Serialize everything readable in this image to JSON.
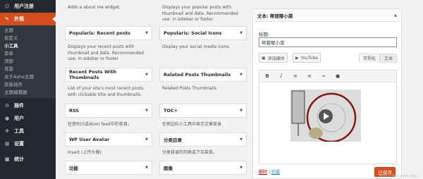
{
  "sidebar": {
    "top_item": "用户注册",
    "current": "外观",
    "submenu": [
      "主题",
      "自定义",
      "小工具",
      "菜单",
      "顶部",
      "背景",
      "关于Ashe主题",
      "安装插件",
      "主题编辑器"
    ],
    "bottom_items": [
      {
        "label": "插件",
        "icon": "plugin-icon"
      },
      {
        "label": "用户",
        "icon": "user-icon"
      },
      {
        "label": "工具",
        "icon": "tools-icon"
      },
      {
        "label": "设置",
        "icon": "settings-icon"
      },
      {
        "label": "统计",
        "icon": "stats-icon"
      }
    ]
  },
  "col1": {
    "top_desc": "Adds a about me widget.",
    "widgets": [
      {
        "title": "Popularis: Recent posts",
        "desc": "Displays your recent posts with thumbnail and date. Recommended use: in sidebar or footer"
      },
      {
        "title": "Recent Posts With Thumbnails",
        "desc": "List of your site's most recent posts, with clickable title and thumbnails."
      },
      {
        "title": "RSS",
        "desc": "任意RSS或Atom feed中的条目。"
      },
      {
        "title": "WP User Avatar",
        "desc": "Insert (上传头像)."
      },
      {
        "title": "功能",
        "desc": ""
      }
    ]
  },
  "col2": {
    "top_desc": "Displays your popular posts with thumbnail and date. Recommended use: in sidebar or footer",
    "widgets": [
      {
        "title": "Popularis: Social Icons",
        "desc": "Display your social media icons."
      },
      {
        "title": "Related Posts Thumbnails",
        "desc": "Related Posts Thumbnails"
      },
      {
        "title": "TOC+",
        "desc": "在侧边栏小工具中显示文章目录"
      },
      {
        "title": "分类目录",
        "desc": "分类目录的列表或下拉菜单。"
      },
      {
        "title": "图像",
        "desc": ""
      }
    ]
  },
  "panel": {
    "title": "文本: 帮我哪小菜",
    "field_label": "标题:",
    "title_value": "帮我哪小菜",
    "add_media": "添加媒体",
    "youtube": "YouTube",
    "visual_tab": "可视化",
    "text_tab": "文本",
    "delete_link": "删除",
    "sep": "|",
    "done_link": "完成",
    "save_button": "已保存",
    "colors": {
      "accent": "#d54e21",
      "link": "#0073aa"
    }
  },
  "watermark": "https://blog.csdn.net/..."
}
